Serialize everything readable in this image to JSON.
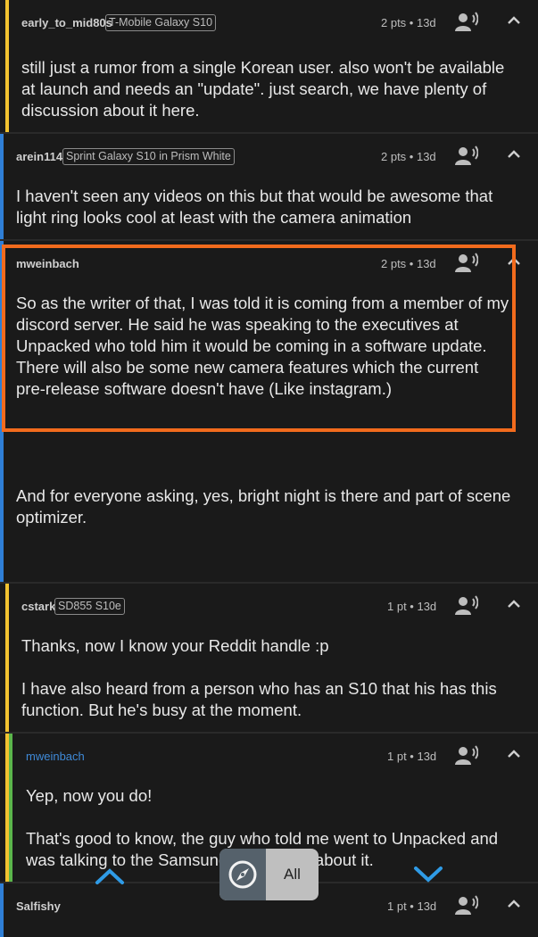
{
  "colors": {
    "bar_yellow": "#f2c230",
    "bar_blue": "#2f7fd6",
    "bar_green": "#5ab54b",
    "highlight": "#f26b1d",
    "op_user": "#3f8ad8"
  },
  "icons": {
    "speak": "speak-icon",
    "collapse": "chevron-up-icon",
    "compass": "compass-icon"
  },
  "comments": [
    {
      "user": "early_to_mid80s",
      "flair": "T-Mobile Galaxy S10",
      "meta": "2 pts • 13d",
      "body": [
        "still just a rumor from a single Korean user. also won't be available at launch and needs an \"update\". just search, we have plenty of discussion about it here."
      ]
    },
    {
      "user": "arein114",
      "flair": "Sprint Galaxy S10 in Prism White",
      "meta": "2 pts • 13d",
      "body": [
        "I haven't seen any videos on this but that would be awesome that light ring looks cool at least with the camera animation"
      ]
    },
    {
      "user": "mweinbach",
      "flair": "",
      "meta": "2 pts • 13d",
      "body": [
        "So as the writer of that, I was told it is coming from a member of my discord server. He said he was speaking to the executives at Unpacked who told him it would be coming in a software update. There will also be some new camera features which the current pre-release software doesn't have (Like instagram.)",
        "And for everyone asking, yes, bright night is there and part of scene optimizer."
      ]
    },
    {
      "user": "cstark",
      "flair": "SD855 S10e",
      "meta": "1 pt • 13d",
      "body": [
        "Thanks, now I know your Reddit handle :p",
        "I have also heard from a person who has an S10 that his has this function. But he's busy at the moment."
      ]
    },
    {
      "user": "mweinbach",
      "flair": "",
      "meta": "1 pt • 13d",
      "body": [
        "Yep, now you do!",
        "That's good to know, the guy who told me went to Unpacked and was talking to the Samsung executives about it."
      ]
    },
    {
      "user": "Salfishy",
      "flair": "",
      "meta": "1 pt • 13d",
      "body": []
    }
  ],
  "nav": {
    "filter_label": "All"
  }
}
